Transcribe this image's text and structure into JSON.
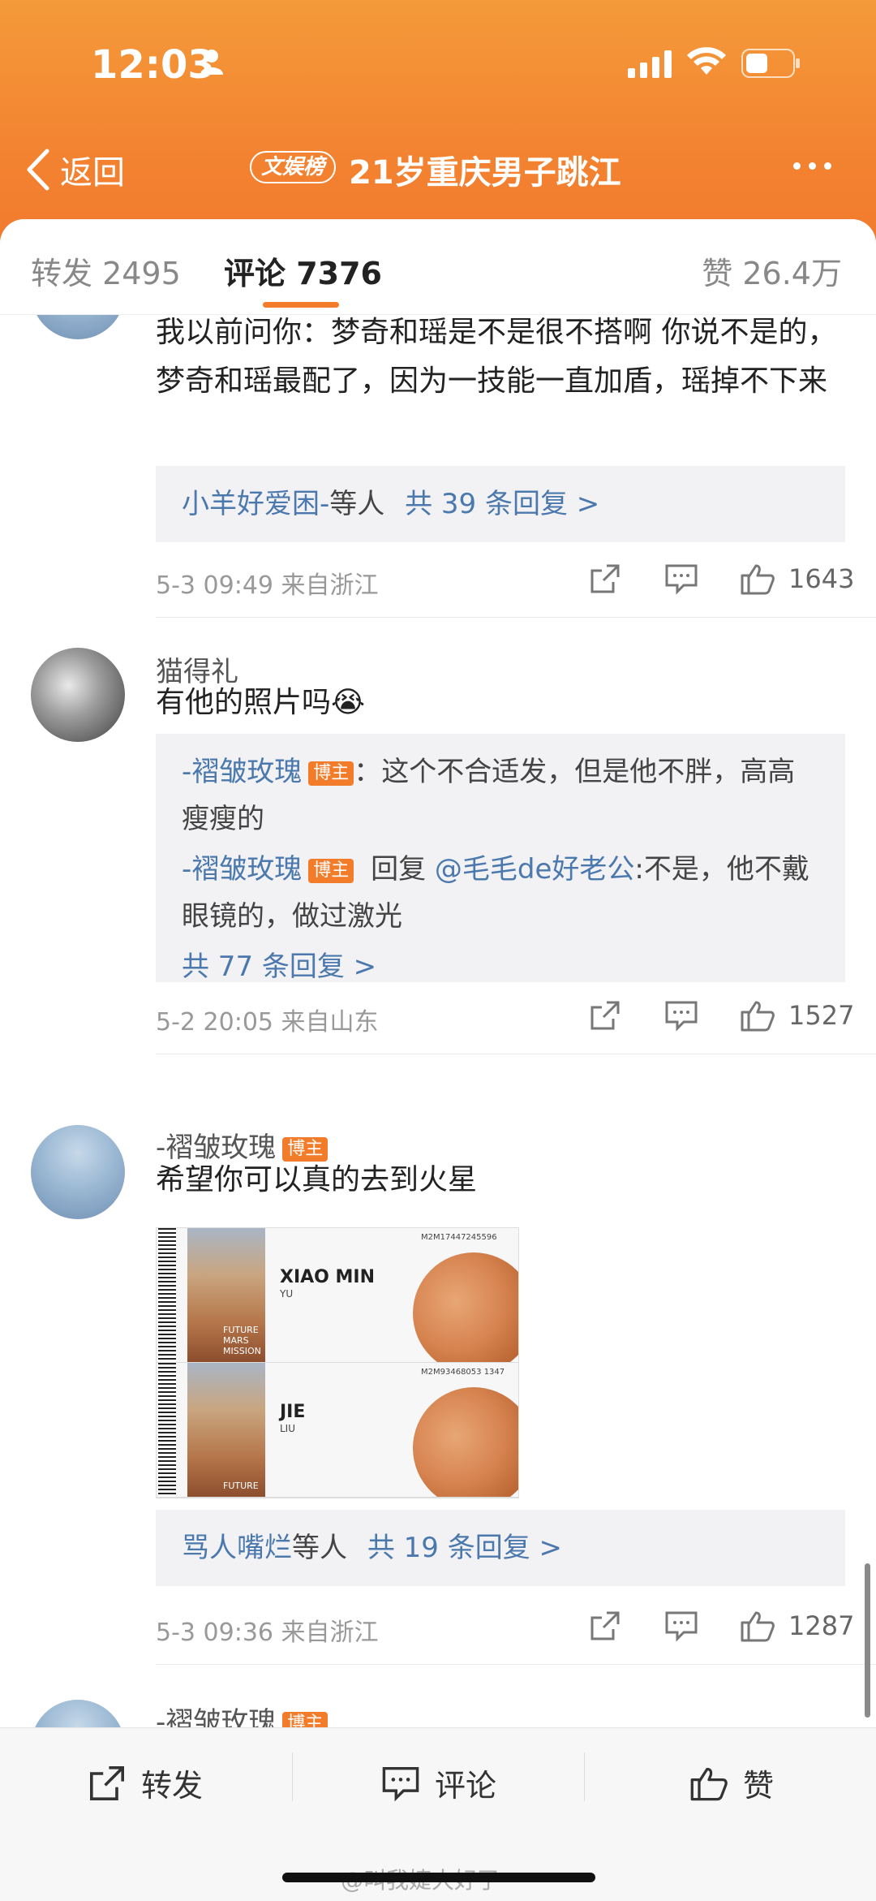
{
  "status": {
    "time": "12:03"
  },
  "nav": {
    "back_label": "返回",
    "badge": "文娱榜",
    "title": "21岁重庆男子跳江"
  },
  "tabs": {
    "repost": "转发 2495",
    "comment": "评论 7376",
    "like": "赞 26.4万"
  },
  "comments": [
    {
      "text": "我以前问你：梦奇和瑶是不是很不搭啊 你说不是的，梦奇和瑶最配了，因为一技能一直加盾，瑶掉不下来",
      "reply_summary_user": "小羊好爱困-",
      "reply_summary_suffix": "等人",
      "reply_summary_link": "共 39 条回复 >",
      "meta": "5-3 09:49 来自浙江",
      "likes": "1643"
    },
    {
      "username": "猫得礼",
      "text": "有他的照片吗😭",
      "replies": [
        {
          "user": "-褶皱玫瑰",
          "tag": "博主",
          "text": "：这个不合适发，但是他不胖，高高瘦瘦的"
        },
        {
          "user": "-褶皱玫瑰",
          "tag": "博主",
          "reply_word": "回复",
          "mention": "@毛毛de好老公",
          "text": ":不是，他不戴眼镜的，做过激光"
        }
      ],
      "reply_link": "共 77 条回复 >",
      "meta": "5-2 20:05 来自山东",
      "likes": "1527"
    },
    {
      "username": "-褶皱玫瑰",
      "tag": "博主",
      "text": "希望你可以真的去到火星",
      "tickets": [
        {
          "name": "XIAO MIN",
          "sub": "YU",
          "code": "M2M17447245596",
          "photo_label": "FUTURE MARS MISSION"
        },
        {
          "name": "JIE",
          "sub": "LIU",
          "code": "M2M93468053 1347",
          "photo_label": "FUTURE"
        }
      ],
      "reply_summary_user": "骂人嘴烂",
      "reply_summary_suffix": "等人",
      "reply_summary_link": "共 19 条回复 >",
      "meta": "5-3 09:36 来自浙江",
      "likes": "1287"
    },
    {
      "username": "-褶皱玫瑰",
      "tag": "博主"
    }
  ],
  "bottom_bar": {
    "repost": "转发",
    "comment": "评论",
    "like": "赞"
  },
  "watermark": "@叫我婕大好了",
  "colors": {
    "accent": "#f37c2b",
    "link": "#4b78ad"
  }
}
